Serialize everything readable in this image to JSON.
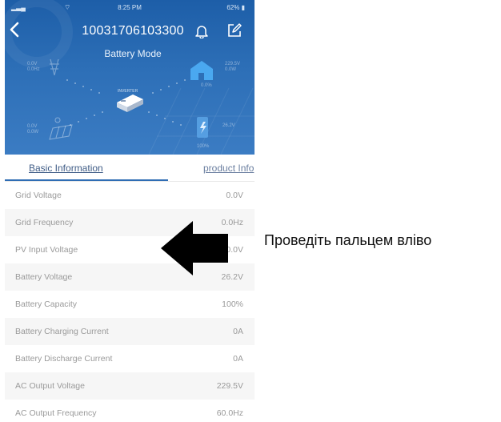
{
  "status_bar": {
    "time": "8:25 PM",
    "battery": "62%"
  },
  "header": {
    "title": "10031706103300",
    "subtitle": "Battery Mode"
  },
  "hero": {
    "grid_voltage": "0.0V",
    "grid_frequency": "0.0Hz",
    "load_voltage": "229.5V",
    "load_power": "0.0W",
    "load_percent": "0.0%",
    "pv_voltage": "0.0V",
    "pv_power": "0.0W",
    "battery_voltage": "26.2V",
    "battery_percent": "100%",
    "inverter_label": "INVERTER"
  },
  "tabs": [
    {
      "label": "Basic Information"
    },
    {
      "label": "product Info"
    }
  ],
  "rows": [
    {
      "label": "Grid Voltage",
      "value": "0.0V"
    },
    {
      "label": "Grid Frequency",
      "value": "0.0Hz"
    },
    {
      "label": "PV Input Voltage",
      "value": "0.0V"
    },
    {
      "label": "Battery Voltage",
      "value": "26.2V"
    },
    {
      "label": "Battery Capacity",
      "value": "100%"
    },
    {
      "label": "Battery Charging Current",
      "value": "0A"
    },
    {
      "label": "Battery Discharge Current",
      "value": "0A"
    },
    {
      "label": "AC Output Voltage",
      "value": "229.5V"
    },
    {
      "label": "AC Output Frequency",
      "value": "60.0Hz"
    }
  ],
  "annotation": {
    "text": "Проведіть пальцем вліво"
  },
  "colors": {
    "header_blue": "#2d6fb7",
    "tab_text": "#3f5c86",
    "row_text": "#9a9a9a"
  }
}
